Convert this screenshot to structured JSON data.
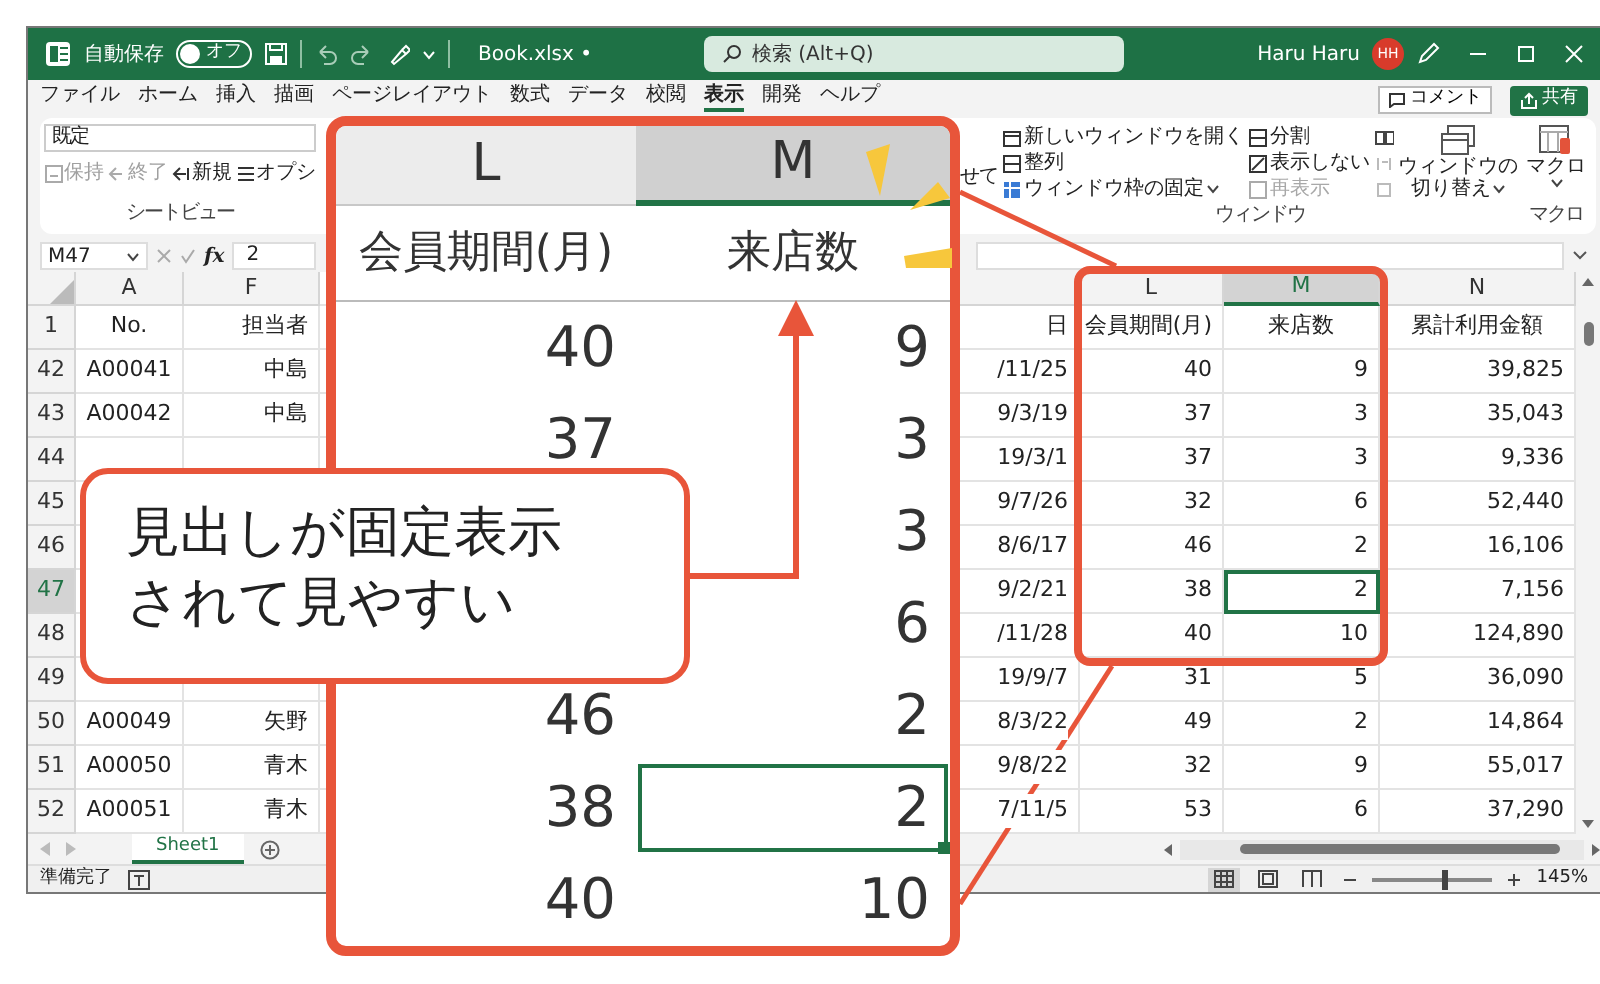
{
  "title_bar": {
    "autosave_label": "自動保存",
    "autosave_toggle": {
      "label": "オフ",
      "on": false
    },
    "file_name": "Book.xlsx •",
    "search": {
      "placeholder": "検索 (Alt+Q)"
    },
    "user_name": "Haru Haru",
    "avatar_initials": "HH"
  },
  "menu": {
    "tabs": [
      {
        "label": "ファイル",
        "selected": false
      },
      {
        "label": "ホーム",
        "selected": false
      },
      {
        "label": "挿入",
        "selected": false
      },
      {
        "label": "描画",
        "selected": false
      },
      {
        "label": "ページレイアウト",
        "selected": false
      },
      {
        "label": "数式",
        "selected": false
      },
      {
        "label": "データ",
        "selected": false
      },
      {
        "label": "校閲",
        "selected": false
      },
      {
        "label": "表示",
        "selected": true
      },
      {
        "label": "開発",
        "selected": false
      },
      {
        "label": "ヘルプ",
        "selected": false
      }
    ],
    "comment_button": "コメント",
    "share_button": "共有"
  },
  "ribbon": {
    "sheet_view": {
      "view_select": "既定",
      "buttons": [
        {
          "label": "保持",
          "disabled": true
        },
        {
          "label": "終了",
          "disabled": true
        },
        {
          "label": "新規",
          "disabled": false
        },
        {
          "label": "オプシ",
          "disabled": false
        }
      ],
      "group_label": "シートビュー"
    },
    "cut_label": "せて",
    "window": {
      "items": [
        {
          "label": "新しいウィンドウを開く",
          "disabled": false,
          "dropdown": false
        },
        {
          "label": "整列",
          "disabled": false,
          "dropdown": false
        },
        {
          "label": "ウィンドウ枠の固定",
          "disabled": false,
          "dropdown": true
        },
        {
          "label": "分割",
          "disabled": false,
          "dropdown": false
        },
        {
          "label": "表示しない",
          "disabled": false,
          "dropdown": false
        },
        {
          "label": "再表示",
          "disabled": true,
          "dropdown": false
        }
      ],
      "switch_button": [
        "ウィンドウの",
        "切り替え"
      ],
      "group_label": "ウィンドウ"
    },
    "macro": {
      "button": "マクロ",
      "group_label": "マクロ"
    }
  },
  "formula_bar": {
    "name_box": "M47",
    "function_label": "fx",
    "formula": "2"
  },
  "sheet": {
    "columns": [
      {
        "letter": "A",
        "selected": false
      },
      {
        "letter": "F",
        "selected": false
      },
      {
        "selected": false
      },
      {
        "letter": "L",
        "selected": false
      },
      {
        "letter": "M",
        "selected": true
      },
      {
        "letter": "N",
        "selected": false
      }
    ],
    "rows": [
      {
        "number": "1",
        "selected": false,
        "cells": [
          "No.",
          "担当者",
          "日",
          "会員期間(月)",
          "来店数",
          "累計利用金額"
        ]
      },
      {
        "number": "42",
        "selected": false,
        "cells": [
          "A00041",
          "中島",
          "/11/25",
          "40",
          "9",
          "39,825"
        ]
      },
      {
        "number": "43",
        "selected": false,
        "cells": [
          "A00042",
          "中島",
          "9/3/19",
          "37",
          "3",
          "35,043"
        ]
      },
      {
        "number": "44",
        "selected": false,
        "cells": [
          null,
          null,
          "19/3/1",
          "37",
          "3",
          "9,336"
        ]
      },
      {
        "number": "45",
        "selected": false,
        "cells": [
          null,
          null,
          "9/7/26",
          "32",
          "6",
          "52,440"
        ]
      },
      {
        "number": "46",
        "selected": false,
        "cells": [
          null,
          null,
          "8/6/17",
          "46",
          "2",
          "16,106"
        ]
      },
      {
        "number": "47",
        "selected": true,
        "cells": [
          null,
          null,
          "9/2/21",
          "38",
          "2",
          "7,156"
        ]
      },
      {
        "number": "48",
        "selected": false,
        "cells": [
          null,
          null,
          "/11/28",
          "40",
          "10",
          "124,890"
        ]
      },
      {
        "number": "49",
        "selected": false,
        "cells": [
          null,
          null,
          "19/9/7",
          "31",
          "5",
          "36,090"
        ]
      },
      {
        "number": "50",
        "selected": false,
        "cells": [
          "A00049",
          "矢野",
          "8/3/22",
          "49",
          "2",
          "14,864"
        ]
      },
      {
        "number": "51",
        "selected": false,
        "cells": [
          "A00050",
          "青木",
          "9/8/22",
          "32",
          "9",
          "55,017"
        ]
      },
      {
        "number": "52",
        "selected": false,
        "cells": [
          "A00051",
          "青木",
          "7/11/5",
          "53",
          "6",
          "37,290"
        ]
      }
    ]
  },
  "sheet_tabs": [
    {
      "label": "Sheet1",
      "selected": true
    }
  ],
  "status_bar": {
    "status": "準備完了",
    "view_buttons": [
      {
        "selected": true
      },
      {
        "selected": false
      },
      {
        "selected": false
      }
    ],
    "zoom_slider": {
      "level": 0.6
    },
    "zoom": "145%"
  },
  "zoom_panel": {
    "columns": [
      {
        "letter": "L",
        "selected": false
      },
      {
        "letter": "M",
        "selected": true
      }
    ],
    "headers": [
      "会員期間(月)",
      "来店数"
    ],
    "rows": [
      {
        "l": "40",
        "m": "9",
        "selected": false
      },
      {
        "l": "37",
        "m": "3",
        "selected": false
      },
      {
        "m": "3",
        "selected": false
      },
      {
        "m": "6",
        "selected": false
      },
      {
        "l": "46",
        "m": "2",
        "selected": false
      },
      {
        "l": "38",
        "m": "2",
        "selected": true
      },
      {
        "l": "40",
        "m": "10",
        "selected": false
      }
    ]
  },
  "callout": {
    "lines": [
      "見出しが固定表示",
      "されて見やすい"
    ]
  }
}
